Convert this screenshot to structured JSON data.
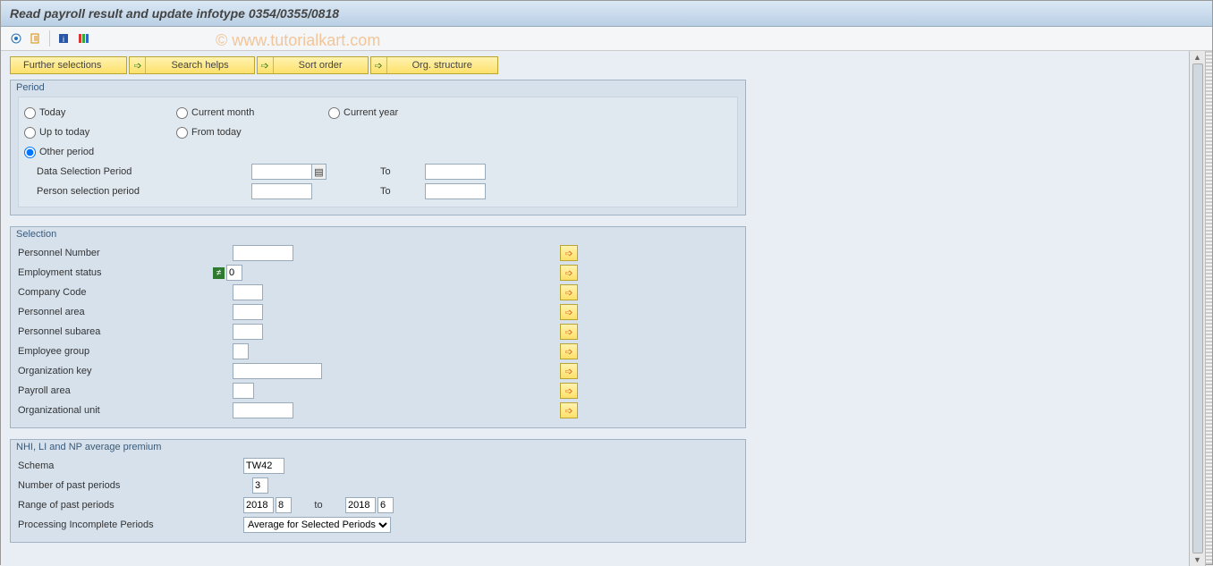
{
  "title": "Read payroll result and update infotype 0354/0355/0818",
  "watermark": "© www.tutorialkart.com",
  "directive_buttons": {
    "further_selections": "Further selections",
    "search_helps": "Search helps",
    "sort_order": "Sort order",
    "org_structure": "Org. structure"
  },
  "period": {
    "legend": "Period",
    "today": "Today",
    "current_month": "Current month",
    "current_year": "Current year",
    "up_to_today": "Up to today",
    "from_today": "From today",
    "other_period": "Other period",
    "data_sel_period": "Data Selection Period",
    "person_sel_period": "Person selection period",
    "to": "To",
    "data_from": "",
    "data_to": "",
    "person_from": "",
    "person_to": ""
  },
  "selection": {
    "legend": "Selection",
    "personnel_number": {
      "label": "Personnel Number",
      "value": ""
    },
    "employment_status": {
      "label": "Employment status",
      "value": "0"
    },
    "company_code": {
      "label": "Company Code",
      "value": ""
    },
    "personnel_area": {
      "label": "Personnel area",
      "value": ""
    },
    "personnel_subarea": {
      "label": "Personnel subarea",
      "value": ""
    },
    "employee_group": {
      "label": "Employee group",
      "value": ""
    },
    "organization_key": {
      "label": "Organization key",
      "value": ""
    },
    "payroll_area": {
      "label": "Payroll area",
      "value": ""
    },
    "organizational_unit": {
      "label": "Organizational unit",
      "value": ""
    }
  },
  "nhi": {
    "legend": "NHI, LI and NP average premium",
    "schema": {
      "label": "Schema",
      "value": "TW42"
    },
    "num_past_periods": {
      "label": "Number of past periods",
      "value": "3"
    },
    "range_past_periods": {
      "label": "Range of past periods",
      "from_y": "2018",
      "from_m": "8",
      "to_lbl": "to",
      "to_y": "2018",
      "to_m": "6"
    },
    "processing_incomplete": {
      "label": "Processing Incomplete Periods",
      "value": "Average for Selected Periods"
    }
  }
}
